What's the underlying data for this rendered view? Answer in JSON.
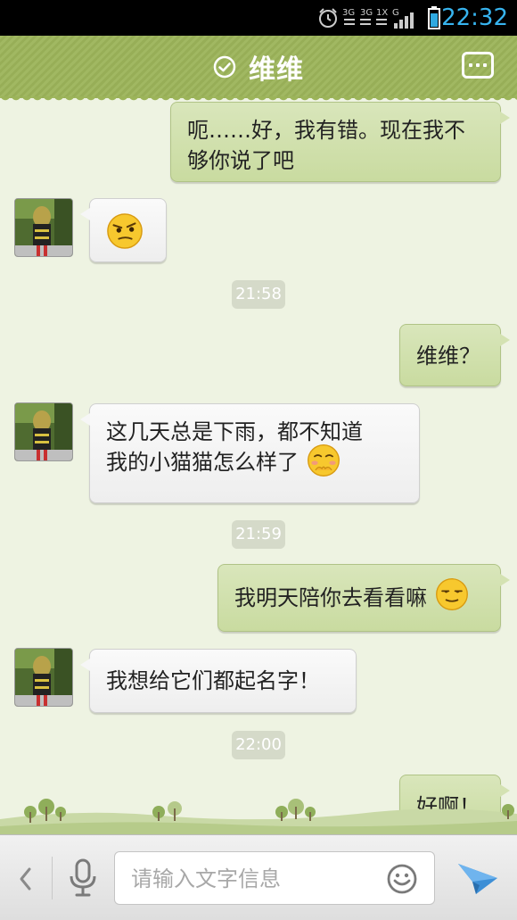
{
  "status_bar": {
    "network_label_1": "3G",
    "network_label_2": "3G",
    "network_label_3": "1X",
    "network_label_4": "G",
    "time": "22:32"
  },
  "header": {
    "title": "维维",
    "status_icon": "check-circle-icon",
    "menu_icon": "more-icon"
  },
  "messages": [
    {
      "dir": "out",
      "text": "呃……好，我有错。现在我不够你说了吧"
    },
    {
      "dir": "in",
      "emoji": "side-eye-emoji"
    },
    {
      "time": "21:58"
    },
    {
      "dir": "out",
      "text": "维维？"
    },
    {
      "dir": "in",
      "text_line1": "这几天总是下雨，都不知道",
      "text_line2": "我的小猫猫怎么样了",
      "emoji": "shy-emoji"
    },
    {
      "time": "21:59"
    },
    {
      "dir": "out",
      "text": "我明天陪你去看看嘛",
      "emoji": "content-emoji"
    },
    {
      "dir": "in",
      "text": "我想给它们都起名字！"
    },
    {
      "time": "22:00"
    },
    {
      "dir": "out",
      "text": "好啊！"
    }
  ],
  "msg1_line1": "呃……好，我有错。现在我不",
  "msg1_line2": "够你说了吧",
  "input_bar": {
    "placeholder": "请输入文字信息",
    "back_icon": "chevron-left-icon",
    "voice_icon": "microphone-icon",
    "emoji_icon": "smiley-icon",
    "send_icon": "send-icon"
  },
  "colors": {
    "header": "#9cb45a",
    "outgoing_bubble": "#d4e2b2",
    "incoming_bubble": "#f6f6f6",
    "time_accent": "#37b4ef",
    "chat_background": "#eef3e2"
  }
}
